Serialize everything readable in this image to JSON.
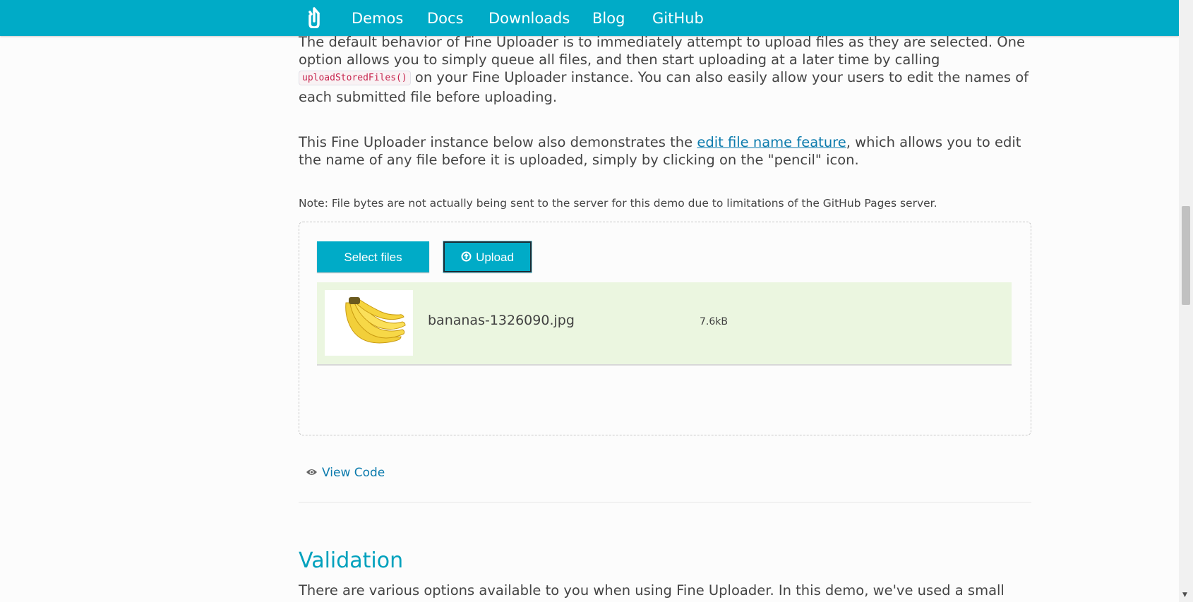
{
  "nav": {
    "items": [
      "Demos",
      "Docs",
      "Downloads",
      "Blog",
      "GitHub"
    ]
  },
  "intro": {
    "p1_part1": "The default behavior of Fine Uploader is to immediately attempt to upload files as they are selected. One option allows you to simply queue all files, and then start uploading at a later time by calling",
    "p1_code": "uploadStoredFiles()",
    "p1_part2": "on your Fine Uploader instance. You can also easily allow your users to edit the names of each submitted file before uploading.",
    "p2_part1": "This Fine Uploader instance below also demonstrates the",
    "p2_link": "edit file name feature",
    "p2_part2": ", which allows you to edit the name of any file before it is uploaded, simply by clicking on the \"pencil\" icon.",
    "note": "Note: File bytes are not actually being sent to the server for this demo due to limitations of the GitHub Pages server."
  },
  "uploader": {
    "select_label": "Select files",
    "upload_label": "Upload",
    "file": {
      "name": "bananas-1326090.jpg",
      "size": "7.6kB"
    }
  },
  "view_code": "View Code",
  "validation": {
    "heading": "Validation",
    "text": "There are various options available to you when using Fine Uploader. In this demo, we've used a small"
  },
  "colors": {
    "brand": "#00abc7",
    "link": "#0c7bad",
    "heading": "#00a1bd",
    "file_row_bg": "#ebf6e0"
  },
  "icons": {
    "logo": "fine-uploader-logo",
    "upload": "upload-circle-icon",
    "view": "eye-icon"
  }
}
